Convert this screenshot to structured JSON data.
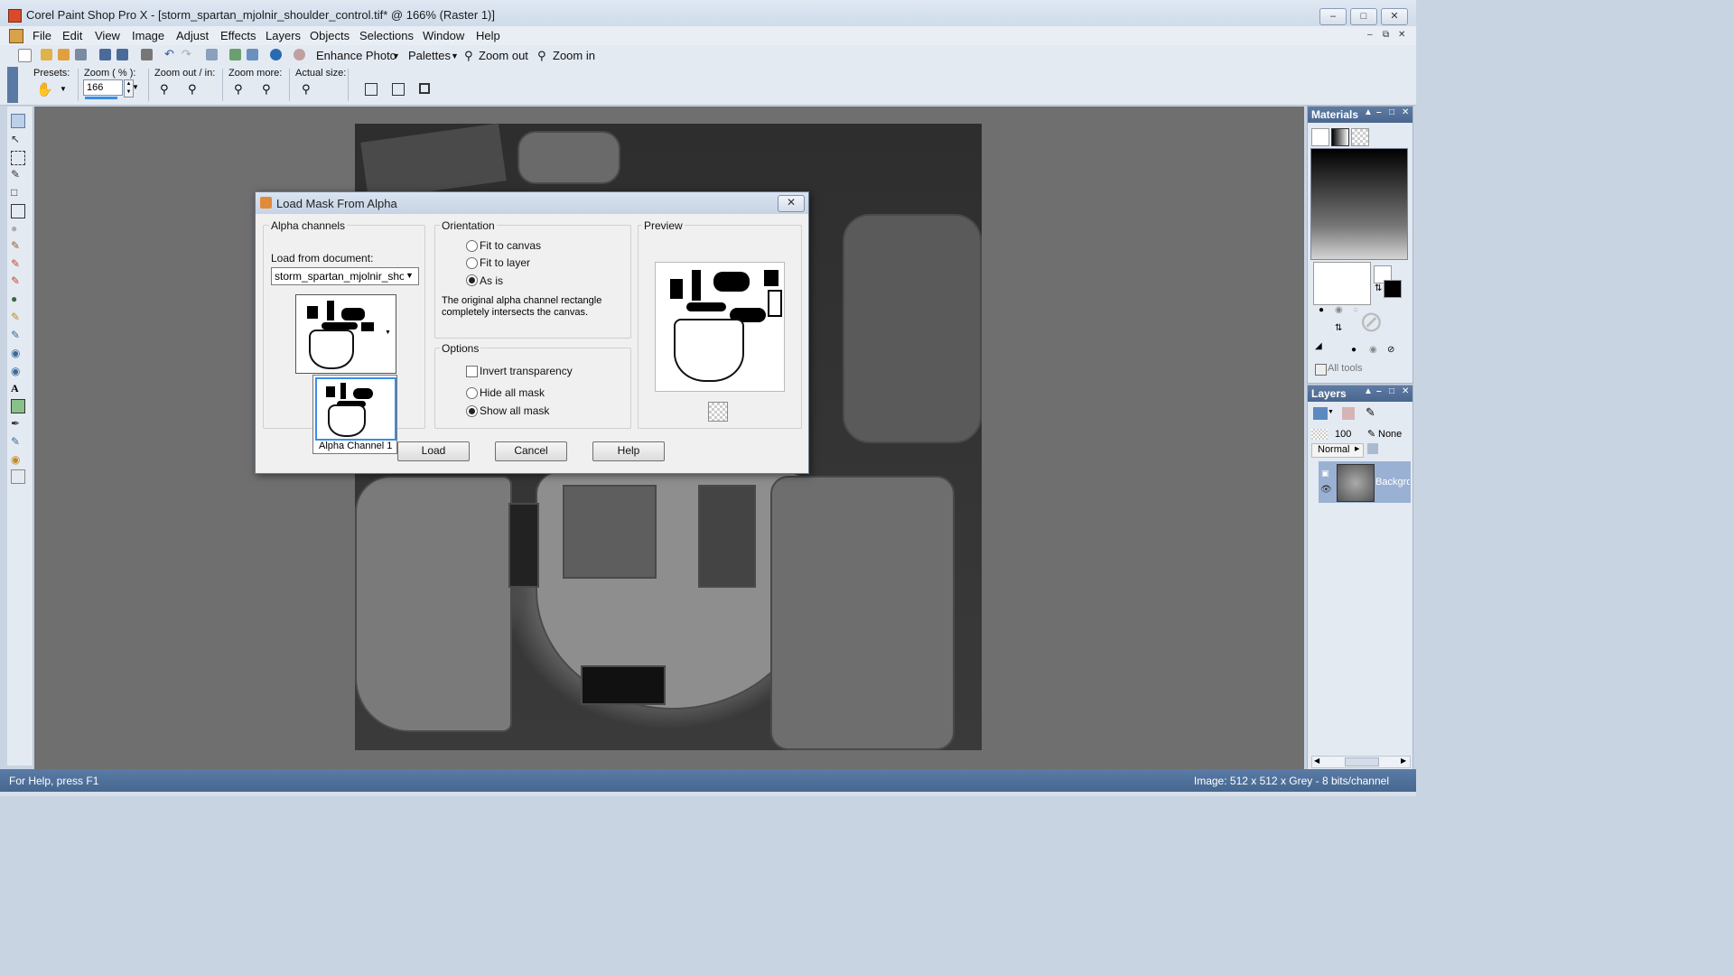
{
  "window": {
    "title": "Corel Paint Shop Pro X - [storm_spartan_mjolnir_shoulder_control.tif* @ 166% (Raster 1)]"
  },
  "menu": [
    "File",
    "Edit",
    "View",
    "Image",
    "Adjust",
    "Effects",
    "Layers",
    "Objects",
    "Selections",
    "Window",
    "Help"
  ],
  "toolbar": {
    "enhance_photo": "Enhance Photo",
    "palettes": "Palettes",
    "zoom_out": "Zoom out",
    "zoom_in": "Zoom in"
  },
  "tool_options": {
    "presets_label": "Presets:",
    "zoom_label": "Zoom ( % ):",
    "zoom_value": "166",
    "zoom_out_in_label": "Zoom out / in:",
    "zoom_more_label": "Zoom more:",
    "actual_size_label": "Actual size:"
  },
  "dialog": {
    "title": "Load Mask From Alpha",
    "alpha_group": "Alpha channels",
    "load_from_label": "Load from document:",
    "document_value": "storm_spartan_mjolnir_shoulder_control.tif",
    "channel_label": "Alpha Channel 1",
    "orientation_group": "Orientation",
    "fit_canvas": "Fit to canvas",
    "fit_layer": "Fit to layer",
    "as_is": "As is",
    "orientation_note": "The original alpha channel rectangle completely intersects the canvas.",
    "options_group": "Options",
    "invert": "Invert transparency",
    "hide_all": "Hide all mask",
    "show_all": "Show all mask",
    "preview_group": "Preview",
    "load_btn": "Load",
    "cancel_btn": "Cancel",
    "help_btn": "Help"
  },
  "materials": {
    "title": "Materials",
    "all_tools": "All tools"
  },
  "layers": {
    "title": "Layers",
    "opacity": "100",
    "blend": "None",
    "mode": "Normal",
    "layer_name": "Background"
  },
  "status": {
    "left": "For Help, press F1",
    "right": "Image:  512 x 512 x Grey - 8 bits/channel"
  }
}
